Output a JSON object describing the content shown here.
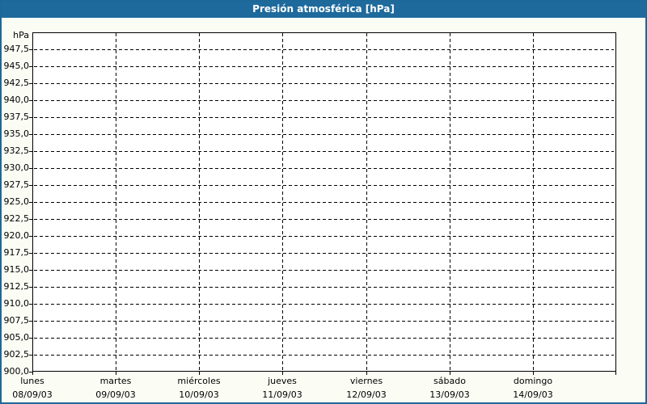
{
  "window": {
    "title": "Presión atmosférica [hPa]"
  },
  "colors": {
    "titlebar_bg": "#1E6A9D",
    "titlebar_text": "#FFFFFF",
    "frame_border": "#1D6899",
    "page_bg": "#FBFDF5",
    "plot_bg": "#FFFFFF",
    "grid": "#000000",
    "text": "#000000"
  },
  "chart_data": {
    "type": "line",
    "title": "Presión atmosférica [hPa]",
    "ylabel": "hPa",
    "y_axis": {
      "unit_label": "hPa",
      "min": 900,
      "max": 950,
      "step": 2.5,
      "tick_labels": [
        "947,5",
        "945,0",
        "942,5",
        "940,0",
        "937,5",
        "935,0",
        "932,5",
        "930,0",
        "927,5",
        "925,0",
        "922,5",
        "920,0",
        "917,5",
        "915,0",
        "912,5",
        "910,0",
        "907,5",
        "905,0",
        "902,5",
        "900,0"
      ]
    },
    "x_axis": {
      "categories": [
        {
          "day": "lunes",
          "date": "08/09/03"
        },
        {
          "day": "martes",
          "date": "09/09/03"
        },
        {
          "day": "miércoles",
          "date": "10/09/03"
        },
        {
          "day": "jueves",
          "date": "11/09/03"
        },
        {
          "day": "viernes",
          "date": "12/09/03"
        },
        {
          "day": "sábado",
          "date": "13/09/03"
        },
        {
          "day": "domingo",
          "date": "14/09/03"
        }
      ]
    },
    "series": [],
    "grid": "dashed",
    "legend": "none"
  }
}
